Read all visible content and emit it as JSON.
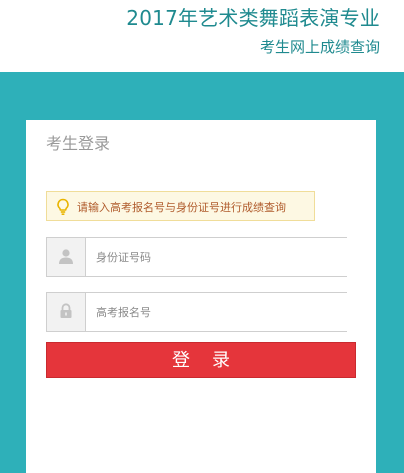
{
  "header": {
    "title": "2017年艺术类舞蹈表演专业",
    "subtitle": "考生网上成绩查询"
  },
  "card": {
    "title": "考生登录",
    "tip": "请输入高考报名号与身份证号进行成绩查询",
    "tip_icon": "lightbulb-icon"
  },
  "fields": {
    "id_card": {
      "placeholder": "身份证号码",
      "value": "",
      "icon": "user-icon"
    },
    "exam_no": {
      "placeholder": "高考报名号",
      "value": "",
      "icon": "lock-icon"
    }
  },
  "login_button": {
    "label": "登录"
  },
  "colors": {
    "accent_teal": "#2eb0b9",
    "title_teal": "#1f8a8f",
    "button_red": "#e5353b",
    "tip_bg": "#fdf8e3"
  }
}
